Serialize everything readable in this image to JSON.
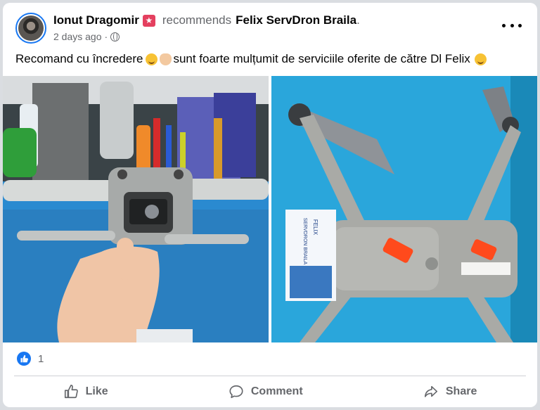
{
  "post": {
    "author": "Ionut Dragomir",
    "recommends_text": "recommends",
    "page_name": "Felix ServDron Braila",
    "trailing_dot": ".",
    "time": "2 days ago",
    "time_separator": "·",
    "text_part1": "Recomand cu încredere",
    "text_part2": "sunt foarte mulțumit de serviciile oferite de către Dl Felix",
    "emojis": [
      "grinning-face-icon",
      "ok-hand-icon",
      "relieved-face-icon"
    ],
    "photo_count": 2
  },
  "photo_right": {
    "card_brand": "FELIX",
    "card_name": "SERVDRON BRAILA"
  },
  "reactions": {
    "count": "1",
    "type": "like-icon"
  },
  "actions": {
    "like_label": "Like",
    "comment_label": "Comment",
    "share_label": "Share"
  },
  "colors": {
    "facebook_blue": "#1877f2",
    "secondary_text": "#65676b",
    "badge_red": "#e4405f",
    "mat_blue": "#27a4d8",
    "drone_gray": "#a9aaa6",
    "sticker_orange": "#ff4a1c"
  }
}
